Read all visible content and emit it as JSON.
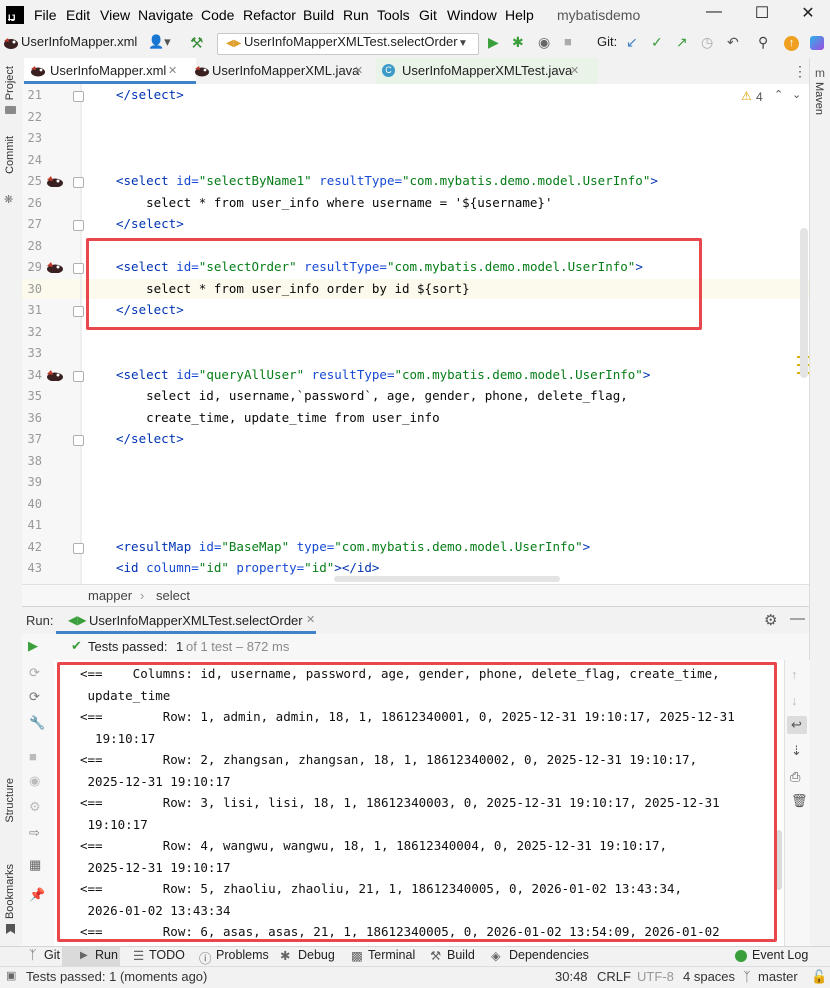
{
  "titlebar": {
    "menus": [
      "File",
      "Edit",
      "View",
      "Navigate",
      "Code",
      "Refactor",
      "Build",
      "Run",
      "Tools",
      "Git",
      "Window",
      "Help"
    ],
    "project": "mybatisdemo"
  },
  "toolbar": {
    "breadcrumb_file": "UserInfoMapper.xml",
    "run_config": "UserInfoMapperXMLTest.selectOrder",
    "git_label": "Git:"
  },
  "left_stripe": {
    "project": "Project",
    "commit": "Commit",
    "structure": "Structure",
    "bookmarks": "Bookmarks"
  },
  "right_stripe": {
    "maven": "Maven"
  },
  "tabs": [
    {
      "label": "UserInfoMapper.xml",
      "active": true
    },
    {
      "label": "UserInfoMapperXML.java",
      "active": false
    },
    {
      "label": "UserInfoMapperXMLTest.java",
      "active": false
    }
  ],
  "editor": {
    "warnings": "4",
    "lines": [
      {
        "n": "21",
        "text": "</select>"
      },
      {
        "n": "22",
        "text": ""
      },
      {
        "n": "23",
        "text": ""
      },
      {
        "n": "24",
        "text": ""
      },
      {
        "n": "25",
        "text": "<select id=\"selectByName1\" resultType=\"com.mybatis.demo.model.UserInfo\">"
      },
      {
        "n": "26",
        "text": "    select * from user_info where username = '${username}'"
      },
      {
        "n": "27",
        "text": "</select>"
      },
      {
        "n": "28",
        "text": ""
      },
      {
        "n": "29",
        "text": "<select id=\"selectOrder\" resultType=\"com.mybatis.demo.model.UserInfo\">"
      },
      {
        "n": "30",
        "text": "    select * from user_info order by id ${sort}"
      },
      {
        "n": "31",
        "text": "</select>"
      },
      {
        "n": "32",
        "text": ""
      },
      {
        "n": "33",
        "text": ""
      },
      {
        "n": "34",
        "text": "<select id=\"queryAllUser\" resultType=\"com.mybatis.demo.model.UserInfo\">"
      },
      {
        "n": "35",
        "text": "    select id, username,`password`, age, gender, phone, delete_flag,"
      },
      {
        "n": "36",
        "text": "    create_time, update_time from user_info"
      },
      {
        "n": "37",
        "text": "</select>"
      },
      {
        "n": "38",
        "text": ""
      },
      {
        "n": "39",
        "text": ""
      },
      {
        "n": "40",
        "text": ""
      },
      {
        "n": "41",
        "text": ""
      },
      {
        "n": "42",
        "text": "<resultMap id=\"BaseMap\" type=\"com.mybatis.demo.model.UserInfo\">"
      },
      {
        "n": "43",
        "text": "<id column=\"id\" property=\"id\"></id>"
      }
    ]
  },
  "breadcrumb": {
    "items": [
      "mapper",
      "select"
    ]
  },
  "run": {
    "label": "Run:",
    "tab": "UserInfoMapperXMLTest.selectOrder",
    "tests_passed": "Tests passed:",
    "count": "1",
    "of_total": "of 1 test – 872 ms",
    "console": [
      "<==    Columns: id, username, password, age, gender, phone, delete_flag, create_time,",
      " update_time",
      "<==        Row: 1, admin, admin, 18, 1, 18612340001, 0, 2025-12-31 19:10:17, 2025-12-31",
      "  19:10:17",
      "<==        Row: 2, zhangsan, zhangsan, 18, 1, 18612340002, 0, 2025-12-31 19:10:17,",
      " 2025-12-31 19:10:17",
      "<==        Row: 3, lisi, lisi, 18, 1, 18612340003, 0, 2025-12-31 19:10:17, 2025-12-31",
      " 19:10:17",
      "<==        Row: 4, wangwu, wangwu, 18, 1, 18612340004, 0, 2025-12-31 19:10:17,",
      " 2025-12-31 19:10:17",
      "<==        Row: 5, zhaoliu, zhaoliu, 21, 1, 18612340005, 0, 2026-01-02 13:43:34,",
      " 2026-01-02 13:43:34",
      "<==        Row: 6, asas, asas, 21, 1, 18612340005, 0, 2026-01-02 13:54:09, 2026-01-02"
    ]
  },
  "bottom_tabs": [
    "Git",
    "Run",
    "TODO",
    "Problems",
    "Debug",
    "Terminal",
    "Build",
    "Dependencies"
  ],
  "event_log": "Event Log",
  "status": {
    "message": "Tests passed: 1 (moments ago)",
    "position": "30:48",
    "line_sep": "CRLF",
    "encoding": "UTF-8",
    "indent": "4 spaces",
    "branch": "master"
  },
  "colors": {
    "accent": "#4083c9",
    "highlight_box": "#e8474b",
    "tag": "#0033b3",
    "string": "#067d17",
    "success": "#3a9e3a"
  }
}
